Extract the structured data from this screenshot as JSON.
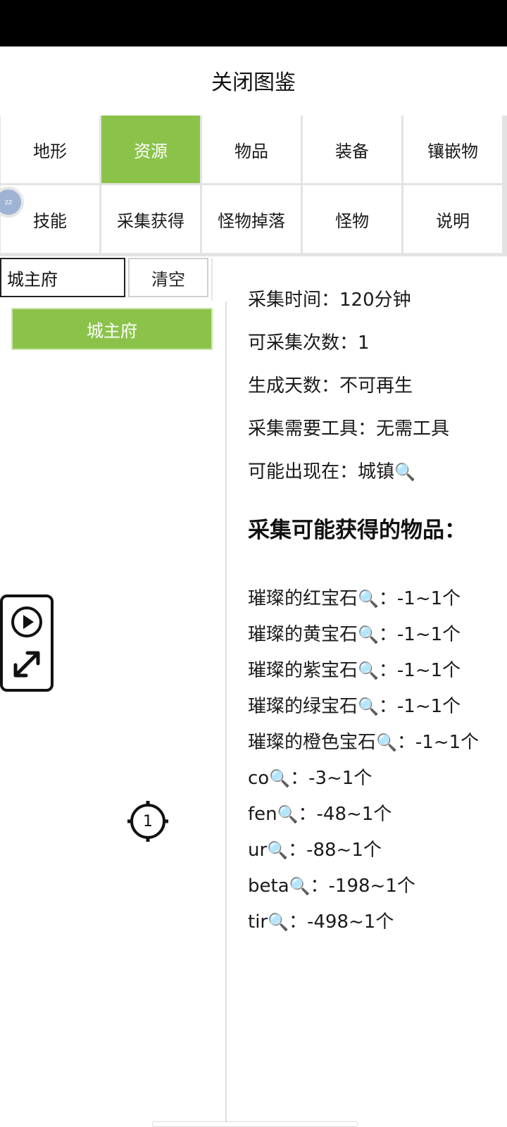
{
  "header": {
    "close_label": "关闭图鉴"
  },
  "tabs": [
    {
      "label": "地形",
      "active": false
    },
    {
      "label": "资源",
      "active": true
    },
    {
      "label": "物品",
      "active": false
    },
    {
      "label": "装备",
      "active": false
    },
    {
      "label": "镶嵌物",
      "active": false
    },
    {
      "label": "技能",
      "active": false
    },
    {
      "label": "采集获得",
      "active": false
    },
    {
      "label": "怪物掉落",
      "active": false
    },
    {
      "label": "怪物",
      "active": false
    },
    {
      "label": "说明",
      "active": false
    }
  ],
  "search": {
    "value": "城主府",
    "clear_label": "清空"
  },
  "results": [
    {
      "label": "城主府",
      "selected": true
    }
  ],
  "detail": {
    "gather_time": "采集时间：120分钟",
    "gather_count": "可采集次数：1",
    "regen_days": "生成天数：不可再生",
    "tool_required": "采集需要工具：无需工具",
    "appears_in_prefix": "可能出现在：",
    "appears_in_link": "城镇",
    "items_title": "采集可能获得的物品：",
    "items": [
      {
        "name": "璀璨的红宝石",
        "qty": "：-1~1个"
      },
      {
        "name": "璀璨的黄宝石",
        "qty": "：-1~1个"
      },
      {
        "name": "璀璨的紫宝石",
        "qty": "：-1~1个"
      },
      {
        "name": "璀璨的绿宝石",
        "qty": "：-1~1个"
      },
      {
        "name": "璀璨的橙色宝石",
        "qty": "：-1~1个"
      },
      {
        "name": "co",
        "qty": "：-3~1个"
      },
      {
        "name": "fen",
        "qty": "：-48~1个"
      },
      {
        "name": "ur",
        "qty": "：-88~1个"
      },
      {
        "name": "beta",
        "qty": "：-198~1个"
      },
      {
        "name": "tir",
        "qty": "：-498~1个"
      }
    ]
  },
  "floating": {
    "avatar_text": "zz",
    "marker_number": "1"
  },
  "icons": {
    "search": "magnifier-icon",
    "play": "play-icon",
    "expand": "expand-arrows-icon",
    "locate": "crosshair-icon"
  },
  "colors": {
    "accent": "#8bc34a",
    "grid_line": "#e3e3e3",
    "status_bar": "#000000"
  },
  "glyphs": {
    "magnifier": "🔍"
  }
}
